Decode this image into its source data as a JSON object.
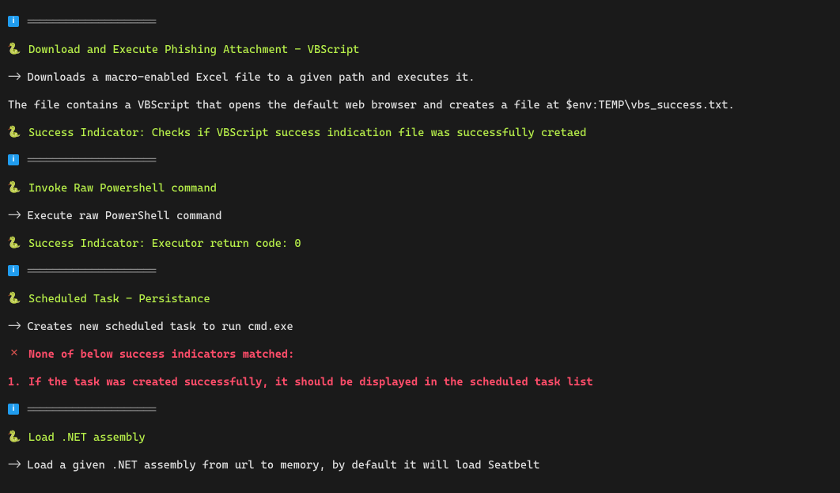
{
  "divider": "====================",
  "arrow": "->",
  "blocks": [
    {
      "title": "Download and Execute Phishing Attachment - VBScript",
      "desc1": "Downloads a macro-enabled Excel file to a given path and executes it.",
      "desc2": "The file contains a VBScript that opens the default web browser and creates a file at $env:TEMP\\vbs_success.txt.",
      "success": "Success Indicator: Checks if VBScript success indication file was successfully cretaed"
    },
    {
      "title": "Invoke Raw Powershell command",
      "desc1": "Execute raw PowerShell command",
      "success": "Success Indicator: Executor return code: 0"
    },
    {
      "title": "Scheduled Task - Persistance",
      "desc1": "Creates new scheduled task to run cmd.exe",
      "fail_msg": "None of below success indicators matched:",
      "fail_num": "1.",
      "fail_item": "If the task was created successfully, it should be displayed in the scheduled task list"
    },
    {
      "title": "Load .NET assembly",
      "desc1": "Load a given .NET assembly from url to memory, by default it will load Seatbelt"
    }
  ]
}
